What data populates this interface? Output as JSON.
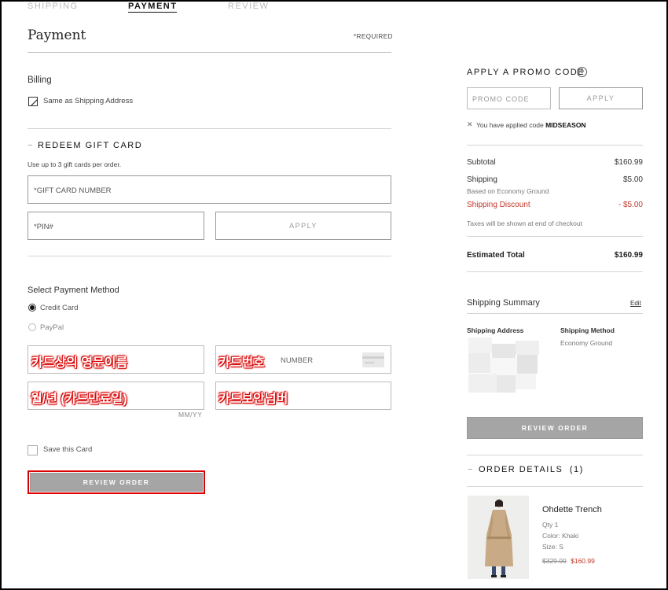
{
  "steps": {
    "shipping": "SHIPPING",
    "payment": "PAYMENT",
    "review": "REVIEW"
  },
  "payment": {
    "title": "Payment",
    "required": "*REQUIRED",
    "billing": {
      "label": "Billing",
      "same_as_shipping": "Same as Shipping Address"
    },
    "gift_card": {
      "heading": "REDEEM GIFT CARD",
      "toggle": "−",
      "help": "Use up to 3 gift cards per order.",
      "number_placeholder": "*GIFT CARD NUMBER",
      "pin_placeholder": "*PIN#",
      "apply_label": "APPLY"
    },
    "method": {
      "label": "Select Payment Method",
      "options": [
        "Credit Card",
        "PayPal"
      ],
      "selected": "Credit Card"
    },
    "card": {
      "name_annotation": "카드상의 영문이름",
      "number_annotation": "카드번호",
      "number_placeholder": "NUMBER",
      "expiry_annotation": "월/년 (카드만료일)",
      "expiry_hint": "MM/YY",
      "cvv_annotation": "카드보안넘버"
    },
    "save_card": "Save this Card",
    "review_order_label": "REVIEW ORDER"
  },
  "summary": {
    "promo": {
      "heading": "APPLY A PROMO CODE",
      "help_icon": "?",
      "placeholder": "PROMO CODE",
      "apply_label": "APPLY",
      "applied_prefix": "You have applied code",
      "applied_code": "MIDSEASON"
    },
    "subtotal_label": "Subtotal",
    "subtotal_value": "$160.99",
    "shipping_label": "Shipping",
    "shipping_value": "$5.00",
    "shipping_sub": "Based on Economy Ground",
    "discount_label": "Shipping Discount",
    "discount_value": "- $5.00",
    "tax_note": "Taxes will be shown at end of checkout",
    "total_label": "Estimated Total",
    "total_value": "$160.99",
    "shipping_summary": {
      "title": "Shipping Summary",
      "edit": "Edit",
      "address_label": "Shipping Address",
      "method_label": "Shipping Method",
      "method_value": "Economy Ground"
    },
    "review_order_label": "REVIEW ORDER",
    "order_details": {
      "heading": "ORDER DETAILS",
      "count": "(1)",
      "toggle": "−",
      "item": {
        "name": "Ohdette Trench",
        "qty": "Qty 1",
        "color": "Color: Khaki",
        "size": "Size: S",
        "original_price": "$329.00",
        "sale_price": "$160.99"
      }
    }
  },
  "colors": {
    "accent_red": "#c0392b",
    "button_gray": "#a5a5a5",
    "annotation_red": "#e00000"
  }
}
